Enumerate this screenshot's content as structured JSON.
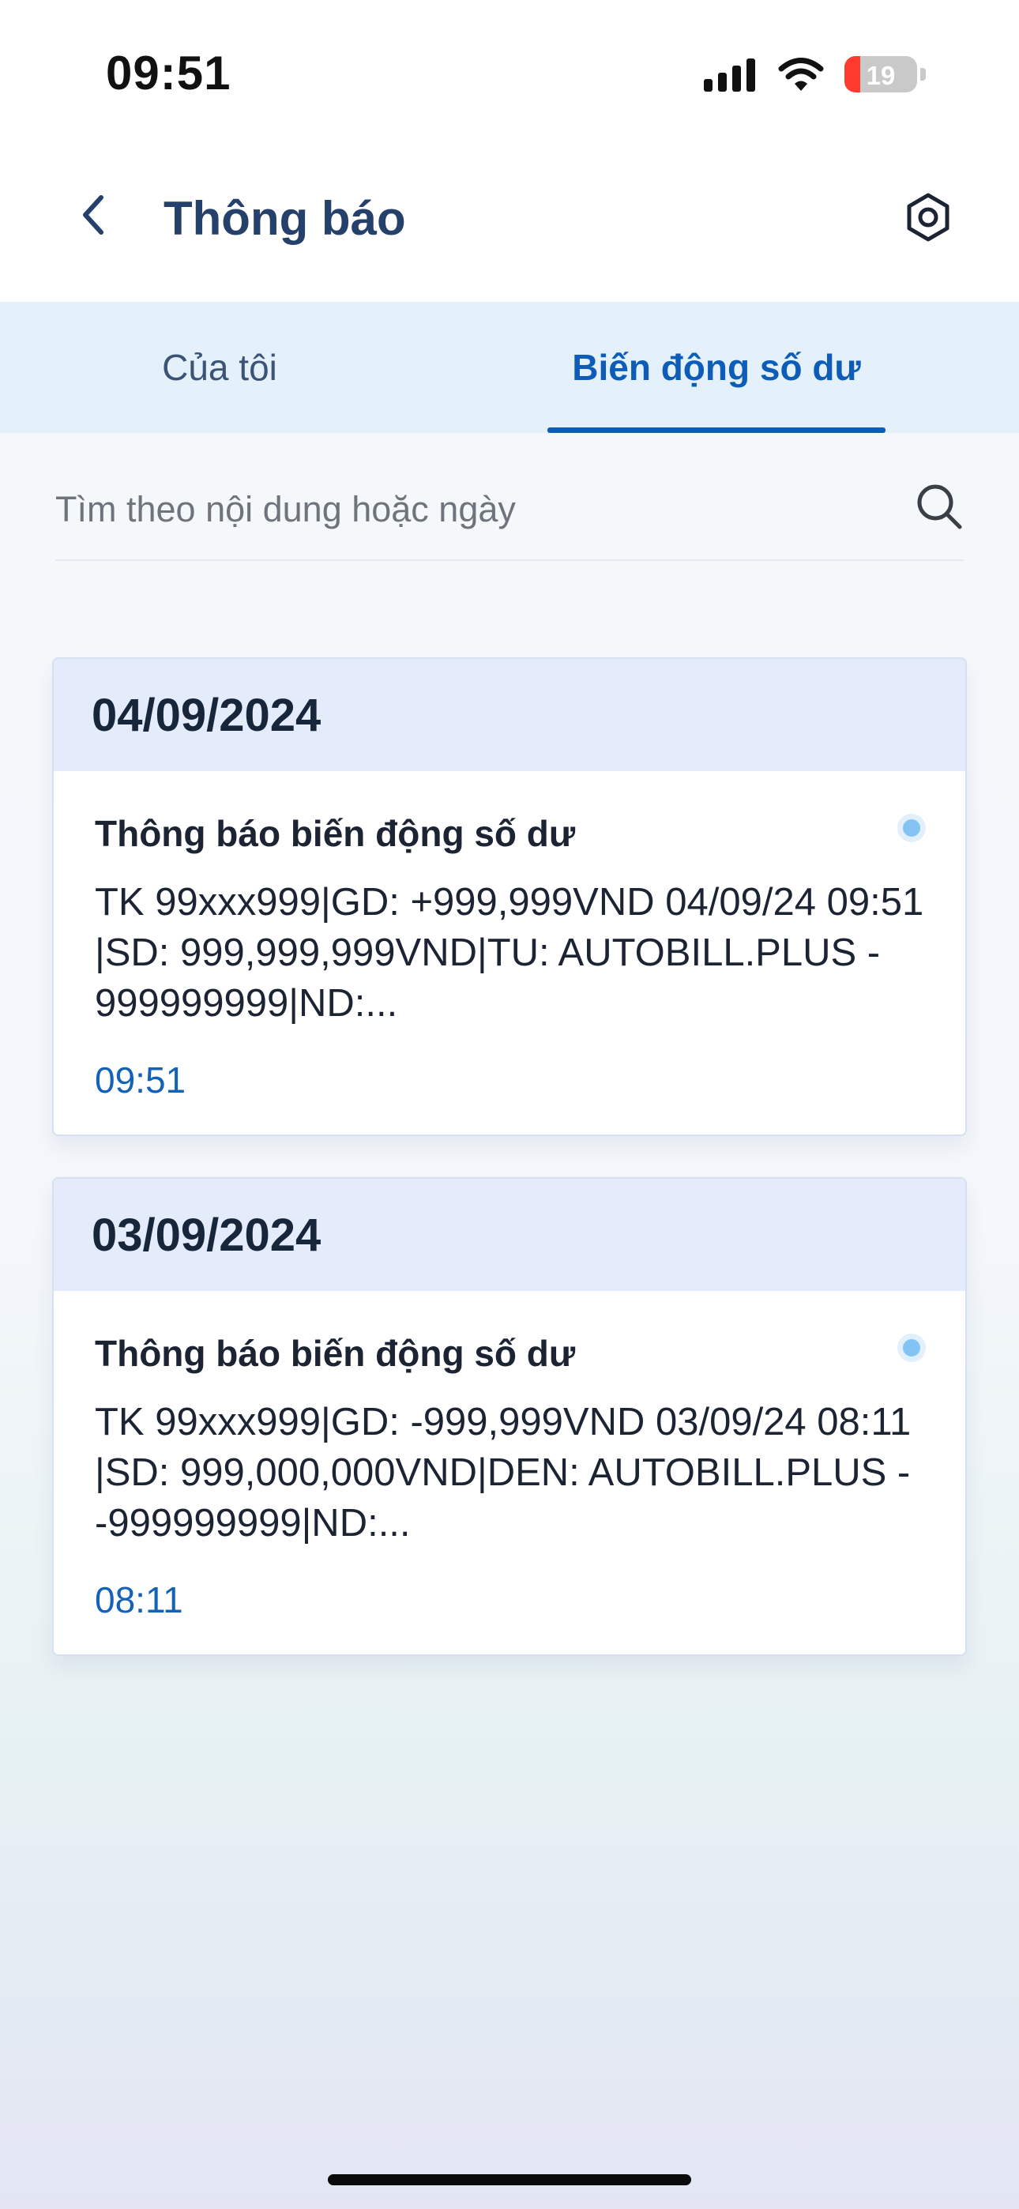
{
  "status_bar": {
    "time": "09:51",
    "battery_level": "19",
    "icons": [
      "cellular-signal-icon",
      "wifi-icon",
      "battery-icon"
    ]
  },
  "header": {
    "title": "Thông báo",
    "back_icon": "chevron-left-icon",
    "settings_icon": "gear-icon"
  },
  "tabs": [
    {
      "label": "Của tôi",
      "active": false
    },
    {
      "label": "Biến động số dư",
      "active": true
    }
  ],
  "search": {
    "placeholder": "Tìm theo nội dung hoặc ngày",
    "value": "",
    "icon": "search-icon"
  },
  "notifications": [
    {
      "date": "04/09/2024",
      "title": "Thông báo biến động số dư",
      "body": "TK 99xxx999|GD: +999,999VND 04/09/24 09:51 |SD: 999,999,999VND|TU: AUTOBILL.PLUS - 999999999|ND:...",
      "time": "09:51",
      "unread": true
    },
    {
      "date": "03/09/2024",
      "title": "Thông báo biến động số dư",
      "body": "TK 99xxx999|GD: -999,999VND 03/09/24 08:11 |SD: 999,000,000VND|DEN: AUTOBILL.PLUS - -999999999|ND:...",
      "time": "08:11",
      "unread": true
    }
  ],
  "colors": {
    "primary": "#0d5db8",
    "title": "#24406b",
    "tab_bar": "#e4f0fa",
    "card_header": "#e4ecfc",
    "unread_dot": "#84c4f5",
    "time_text": "#1462b8",
    "battery_low": "#ff3b30"
  }
}
